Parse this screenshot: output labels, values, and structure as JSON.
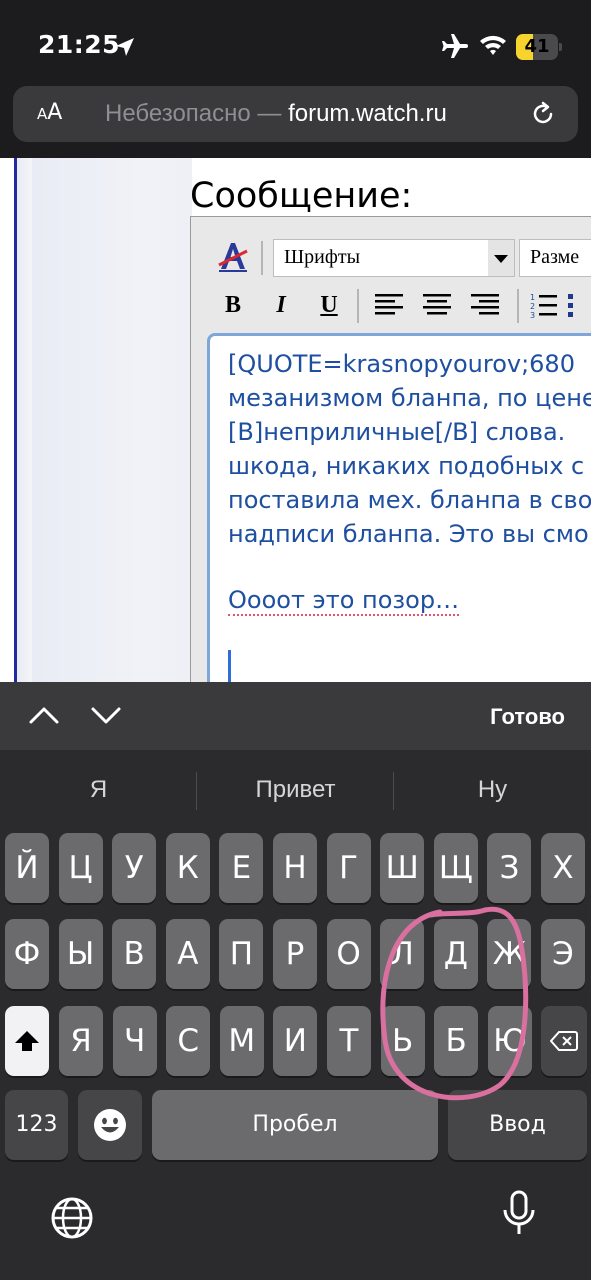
{
  "status_bar": {
    "time": "21:25",
    "battery_level": "41",
    "battery_fraction": 0.41
  },
  "url_bar": {
    "aa_small": "A",
    "aa_big": "A",
    "insecure_label": "Небезопасно — ",
    "domain": "forum.watch.ru"
  },
  "page": {
    "message_label": "Сообщение:",
    "toolbar": {
      "font_select": "Шрифты",
      "size_select": "Разме",
      "bold": "B",
      "italic": "I",
      "underline": "U"
    },
    "editor_lines": [
      "[QUOTE=krasnopyourov;680",
      "мезанизмом бланпа, по цене",
      "[B]неприличные[/B] слова.",
      "шкода, никаких подобных с",
      "поставила мех. бланпа в сво",
      "надписи бланпа. Это вы смо"
    ],
    "editor_reply": "Оооот это позор…"
  },
  "accessory_bar": {
    "done_label": "Готово"
  },
  "keyboard": {
    "suggestions": [
      "Я",
      "Привет",
      "Ну"
    ],
    "row1": [
      "Й",
      "Ц",
      "У",
      "К",
      "Е",
      "Н",
      "Г",
      "Ш",
      "Щ",
      "З",
      "Х"
    ],
    "row2": [
      "Ф",
      "Ы",
      "В",
      "А",
      "П",
      "Р",
      "О",
      "Л",
      "Д",
      "Ж",
      "Э"
    ],
    "row3": [
      "Я",
      "Ч",
      "С",
      "М",
      "И",
      "Т",
      "Ь",
      "Б",
      "Ю"
    ],
    "numbers_label": "123",
    "space_label": "Пробел",
    "return_label": "Ввод"
  },
  "colors": {
    "annotation_circle": "#d9709f",
    "editor_text": "#1e4fa0",
    "key_bg": "#6b6b6d"
  }
}
